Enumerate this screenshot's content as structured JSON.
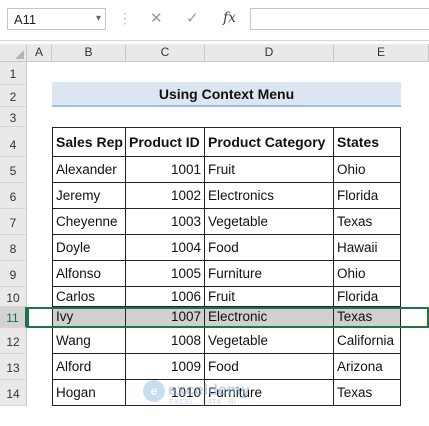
{
  "formula_bar": {
    "name_box": "A11",
    "name_box_arrow": "▾",
    "separator": "⋮",
    "cancel_icon": "✕",
    "enter_icon": "✓",
    "fx_label": "fx",
    "formula": ""
  },
  "columns": [
    "A",
    "B",
    "C",
    "D",
    "E"
  ],
  "rows": [
    "1",
    "2",
    "3",
    "4",
    "5",
    "6",
    "7",
    "8",
    "9",
    "10",
    "11",
    "12",
    "13",
    "14"
  ],
  "selected_row": "11",
  "title": "Using Context Menu",
  "table": {
    "headers": [
      "Sales Rep",
      "Product ID",
      "Product Category",
      "States"
    ],
    "rows": [
      [
        "Alexander",
        "1001",
        "Fruit",
        "Ohio"
      ],
      [
        "Jeremy",
        "1002",
        "Electronics",
        "Florida"
      ],
      [
        "Cheyenne",
        "1003",
        "Vegetable",
        "Texas"
      ],
      [
        "Doyle",
        "1004",
        "Food",
        "Hawaii"
      ],
      [
        "Alfonso",
        "1005",
        "Furniture",
        "Ohio"
      ],
      [
        "Carlos",
        "1006",
        "Fruit",
        "Florida"
      ],
      [
        "Ivy",
        "1007",
        "Electronic",
        "Texas"
      ],
      [
        "Wang",
        "1008",
        "Vegetable",
        "California"
      ],
      [
        "Alford",
        "1009",
        "Food",
        "Arizona"
      ],
      [
        "Hogan",
        "1010",
        "Furniture",
        "Texas"
      ]
    ],
    "highlighted_row_index": 6
  },
  "watermark": {
    "name": "exceldemy",
    "tagline": "EXCEL · DATA · BI",
    "logo_letter": "e"
  },
  "colors": {
    "selection": "#217346",
    "title_fill": "#dce6f1",
    "title_underline": "#9bc2e6",
    "highlight_fill": "#d0d0d0"
  }
}
